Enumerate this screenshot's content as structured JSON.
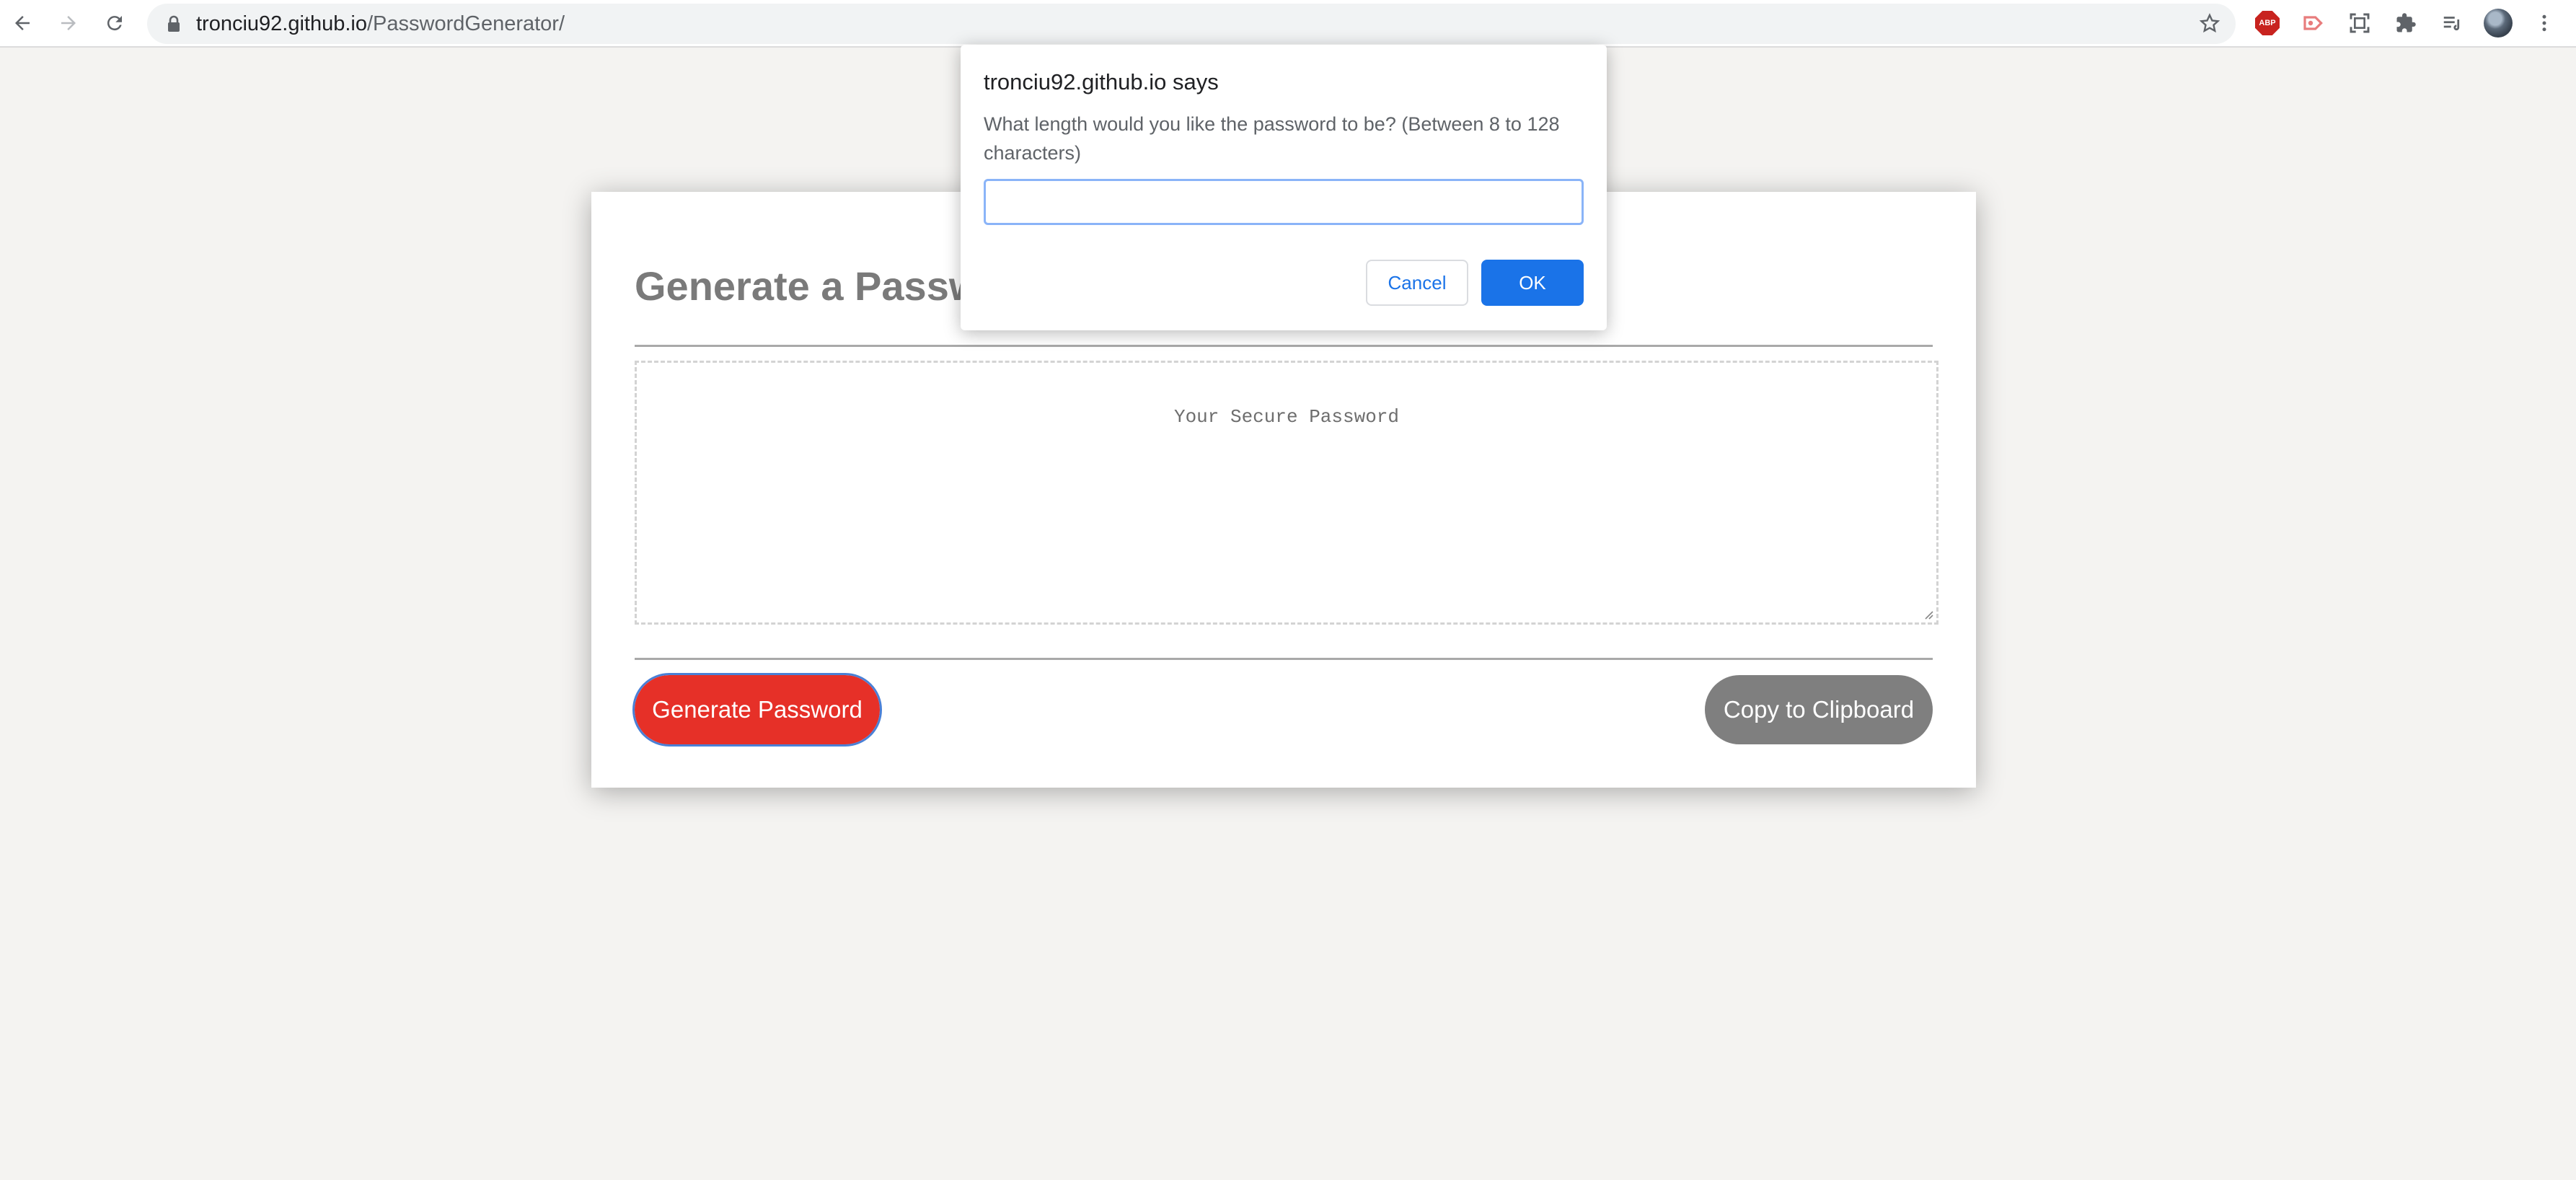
{
  "browser": {
    "url_host": "tronciu92.github.io",
    "url_path": "/PasswordGenerator/",
    "nav_icons": [
      "back-arrow-icon",
      "forward-arrow-icon",
      "reload-icon"
    ],
    "extension_icons": [
      "adblock-plus-icon",
      "cast-extension-icon",
      "screenshot-icon",
      "extensions-puzzle-icon",
      "reading-list-icon",
      "profile-avatar",
      "menu-kebab-icon"
    ],
    "abp_label": "ABP"
  },
  "page": {
    "title": "Generate a Password",
    "password_placeholder": "Your Secure Password",
    "generate_label": "Generate Password",
    "copy_label": "Copy to Clipboard",
    "colors": {
      "generate": "#e63028",
      "copy": "#7f7f7f",
      "title": "#7a7a7a"
    }
  },
  "dialog": {
    "title": "tronciu92.github.io says",
    "message": "What length would you like the password to be? (Between 8 to 128 characters)",
    "input_value": "",
    "cancel_label": "Cancel",
    "ok_label": "OK",
    "colors": {
      "ok": "#1a73e8",
      "focus_ring": "#8ab4f8"
    }
  }
}
